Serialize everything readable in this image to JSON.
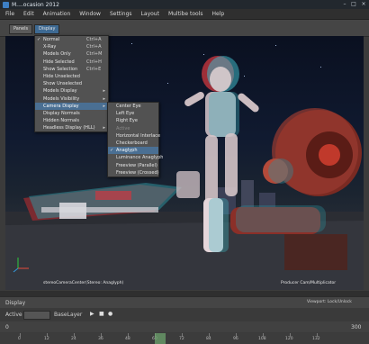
{
  "window": {
    "title": "M....ocasion 2012"
  },
  "menubar": {
    "items": [
      "File",
      "Edit",
      "Animation",
      "Window",
      "Settings",
      "Layout",
      "Multibe tools",
      "Help"
    ]
  },
  "panel_toolbar": {
    "buttons": [
      "Panels",
      "Display"
    ]
  },
  "display_menu": {
    "items": [
      {
        "label": "Normal",
        "shortcut": "Ctrl+A",
        "checked": true
      },
      {
        "label": "X-Ray",
        "shortcut": "Ctrl+A",
        "checked": false
      },
      {
        "label": "Models Only",
        "shortcut": "Ctrl+M",
        "checked": false
      },
      {
        "label": "Hide Selected",
        "shortcut": "Ctrl+H",
        "checked": false
      },
      {
        "label": "Show Selection",
        "shortcut": "Ctrl+E",
        "checked": false
      },
      {
        "label": "Hide Unselected",
        "shortcut": "",
        "checked": false
      },
      {
        "label": "Show Unselected",
        "shortcut": "",
        "checked": false
      },
      {
        "label": "Models Display",
        "shortcut": "",
        "checked": false,
        "submenu": true
      },
      {
        "label": "Models Visibility",
        "shortcut": "",
        "checked": false,
        "submenu": true
      },
      {
        "label": "Camera Display",
        "shortcut": "",
        "checked": false,
        "submenu": true,
        "highlighted": true
      },
      {
        "label": "Display Normals",
        "shortcut": "",
        "checked": false
      },
      {
        "label": "Hidden Normals",
        "shortcut": "",
        "checked": false
      },
      {
        "label": "Headless Display (HLL)",
        "shortcut": "",
        "checked": false,
        "submenu": true
      }
    ]
  },
  "camera_submenu": {
    "items": [
      {
        "label": "Center Eye",
        "checked": false,
        "disabled": false
      },
      {
        "label": "Left Eye",
        "checked": false,
        "disabled": false
      },
      {
        "label": "Right Eye",
        "checked": false,
        "disabled": false
      },
      {
        "label": "Active",
        "checked": false,
        "disabled": true
      },
      {
        "label": "Horizontal Interlace",
        "checked": false,
        "disabled": false
      },
      {
        "label": "Checkerboard",
        "checked": false,
        "disabled": false
      },
      {
        "label": "Anaglyph",
        "checked": true,
        "disabled": false,
        "highlighted": true
      },
      {
        "label": "Luminance Anaglyph",
        "checked": false,
        "disabled": false
      },
      {
        "label": "Freeview (Parallel)",
        "checked": false,
        "disabled": false
      },
      {
        "label": "Freeview (Crossed)",
        "checked": false,
        "disabled": false
      }
    ]
  },
  "viewport": {
    "hud_left": "stereoCameraCenter(Stereo: Anaglyph)",
    "hud_right": "Producer Cam/Multiplicator"
  },
  "timeline": {
    "mode_label": "Display",
    "right_label": "Viewport: Lock/Unlock",
    "take_label": "Active",
    "layer_label": "BaseLayer",
    "start_value": "0",
    "end_value": "300",
    "tick_labels": [
      "0",
      "12",
      "24",
      "36",
      "48",
      "60",
      "72",
      "84",
      "96",
      "108",
      "120",
      "132"
    ]
  },
  "colors": {
    "highlight": "#4a6f93",
    "accent": "#3d7fc4"
  }
}
